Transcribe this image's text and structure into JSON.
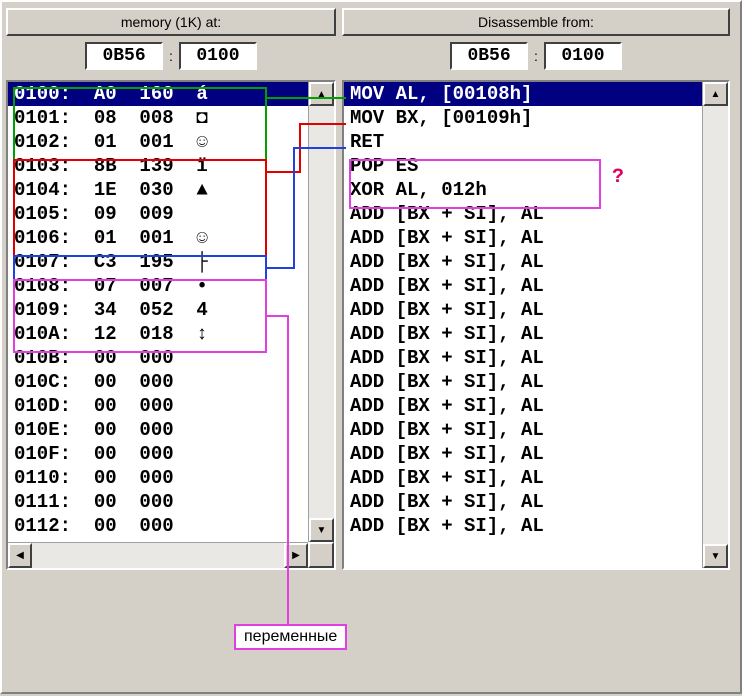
{
  "memory_panel": {
    "button_label": "memory (1K) at:",
    "segment": "0B56",
    "colon": ":",
    "offset": "0100",
    "rows": [
      {
        "addr": "0100",
        "hex": "A0",
        "dec": "160",
        "char": "á",
        "sel": true
      },
      {
        "addr": "0101",
        "hex": "08",
        "dec": "008",
        "char": "◘",
        "sel": false
      },
      {
        "addr": "0102",
        "hex": "01",
        "dec": "001",
        "char": "☺",
        "sel": false
      },
      {
        "addr": "0103",
        "hex": "8B",
        "dec": "139",
        "char": "ï",
        "sel": false
      },
      {
        "addr": "0104",
        "hex": "1E",
        "dec": "030",
        "char": "▲",
        "sel": false
      },
      {
        "addr": "0105",
        "hex": "09",
        "dec": "009",
        "char": " ",
        "sel": false
      },
      {
        "addr": "0106",
        "hex": "01",
        "dec": "001",
        "char": "☺",
        "sel": false
      },
      {
        "addr": "0107",
        "hex": "C3",
        "dec": "195",
        "char": "├",
        "sel": false
      },
      {
        "addr": "0108",
        "hex": "07",
        "dec": "007",
        "char": "•",
        "sel": false
      },
      {
        "addr": "0109",
        "hex": "34",
        "dec": "052",
        "char": "4",
        "sel": false
      },
      {
        "addr": "010A",
        "hex": "12",
        "dec": "018",
        "char": "↕",
        "sel": false
      },
      {
        "addr": "010B",
        "hex": "00",
        "dec": "000",
        "char": " ",
        "sel": false
      },
      {
        "addr": "010C",
        "hex": "00",
        "dec": "000",
        "char": " ",
        "sel": false
      },
      {
        "addr": "010D",
        "hex": "00",
        "dec": "000",
        "char": " ",
        "sel": false
      },
      {
        "addr": "010E",
        "hex": "00",
        "dec": "000",
        "char": " ",
        "sel": false
      },
      {
        "addr": "010F",
        "hex": "00",
        "dec": "000",
        "char": " ",
        "sel": false
      },
      {
        "addr": "0110",
        "hex": "00",
        "dec": "000",
        "char": " ",
        "sel": false
      },
      {
        "addr": "0111",
        "hex": "00",
        "dec": "000",
        "char": " ",
        "sel": false
      },
      {
        "addr": "0112",
        "hex": "00",
        "dec": "000",
        "char": " ",
        "sel": false
      }
    ]
  },
  "disasm_panel": {
    "button_label": "Disassemble from:",
    "segment": "0B56",
    "colon": ":",
    "offset": "0100",
    "rows": [
      {
        "text": "MOV AL, [00108h]",
        "sel": true
      },
      {
        "text": "MOV BX, [00109h]",
        "sel": false
      },
      {
        "text": "RET",
        "sel": false
      },
      {
        "text": "POP ES",
        "sel": false
      },
      {
        "text": "XOR AL, 012h",
        "sel": false
      },
      {
        "text": "ADD [BX + SI], AL",
        "sel": false
      },
      {
        "text": "ADD [BX + SI], AL",
        "sel": false
      },
      {
        "text": "ADD [BX + SI], AL",
        "sel": false
      },
      {
        "text": "ADD [BX + SI], AL",
        "sel": false
      },
      {
        "text": "ADD [BX + SI], AL",
        "sel": false
      },
      {
        "text": "ADD [BX + SI], AL",
        "sel": false
      },
      {
        "text": "ADD [BX + SI], AL",
        "sel": false
      },
      {
        "text": "ADD [BX + SI], AL",
        "sel": false
      },
      {
        "text": "ADD [BX + SI], AL",
        "sel": false
      },
      {
        "text": "ADD [BX + SI], AL",
        "sel": false
      },
      {
        "text": "ADD [BX + SI], AL",
        "sel": false
      },
      {
        "text": "ADD [BX + SI], AL",
        "sel": false
      },
      {
        "text": "ADD [BX + SI], AL",
        "sel": false
      },
      {
        "text": "ADD [BX + SI], AL",
        "sel": false
      }
    ]
  },
  "annotations": {
    "question_mark": "?",
    "callout_label": "переменные",
    "box_colors": {
      "green": "#00a000",
      "red": "#e00000",
      "blue": "#2040e0",
      "magenta": "#e040e0"
    }
  },
  "scroll_icons": {
    "up": "▲",
    "down": "▼",
    "left": "◀",
    "right": "▶"
  }
}
